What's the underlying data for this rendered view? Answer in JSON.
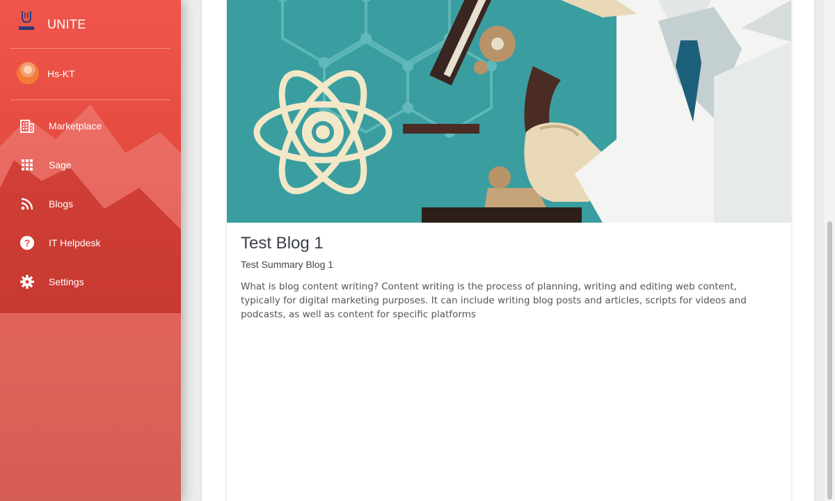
{
  "brand": {
    "name": "UNITE",
    "logo_text": "UNITE"
  },
  "user": {
    "name": "Hs-KT"
  },
  "nav": [
    {
      "label": "Marketplace",
      "icon": "building-icon"
    },
    {
      "label": "Sage",
      "icon": "apps-grid-icon"
    },
    {
      "label": "Blogs",
      "icon": "rss-icon"
    },
    {
      "label": "IT Helpdesk",
      "icon": "help-circle-icon"
    },
    {
      "label": "Settings",
      "icon": "gear-icon"
    }
  ],
  "blog": {
    "title": "Test Blog 1",
    "summary": "Test Summary Blog 1",
    "body": "What is blog content writing? Content writing is the process of planning, writing and editing web content, typically for digital marketing purposes. It can include writing blog posts and articles, scripts for videos and podcasts, as well as content for specific platforms",
    "image": "science-microscope-illustration"
  },
  "colors": {
    "sidebar": "#e94b40",
    "hero_bg": "#3a9ea0",
    "title": "#3b3f4a"
  }
}
